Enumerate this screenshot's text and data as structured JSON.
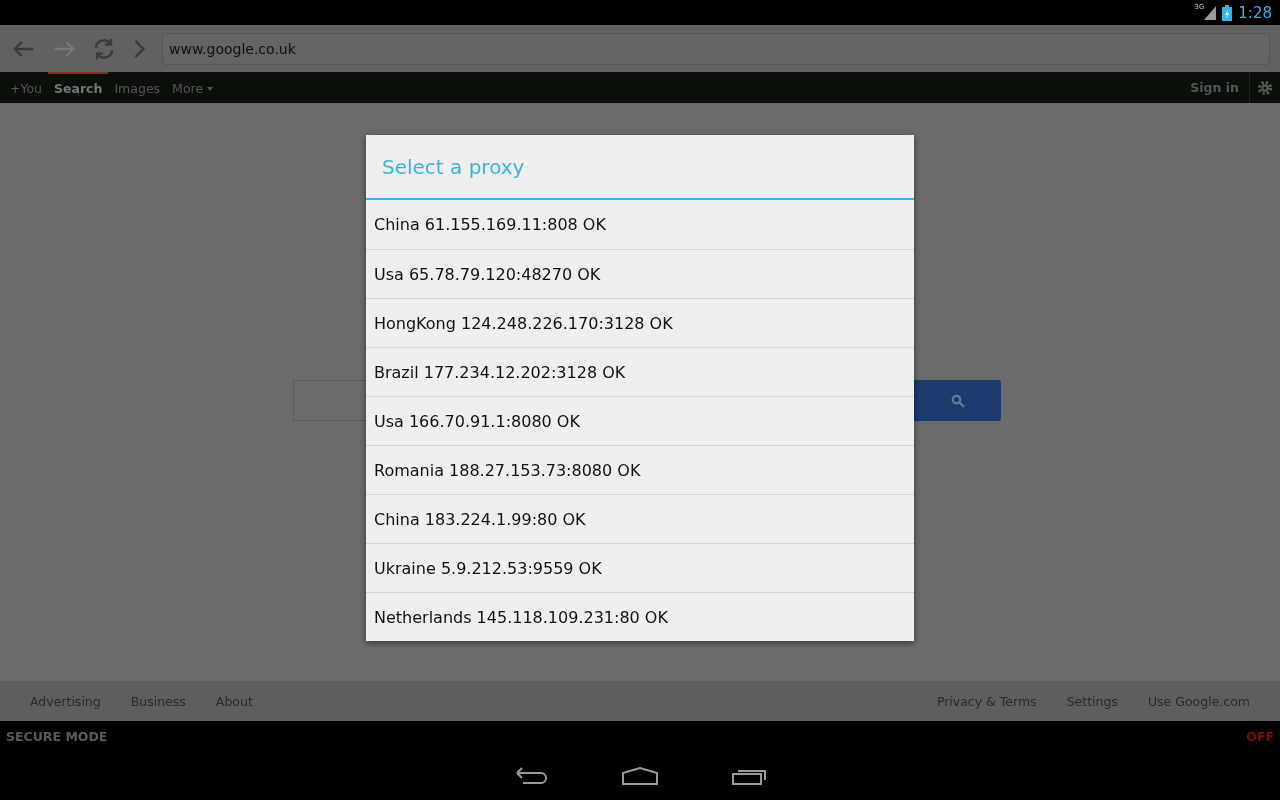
{
  "status_bar": {
    "network": "3G",
    "time": "1:28"
  },
  "browser": {
    "url": "www.google.co.uk"
  },
  "google_nav": {
    "tabs": [
      {
        "label": "+You",
        "selected": false
      },
      {
        "label": "Search",
        "selected": true
      },
      {
        "label": "Images",
        "selected": false
      },
      {
        "label": "More",
        "selected": false,
        "dropdown": true
      }
    ],
    "sign_in": "Sign in"
  },
  "dialog": {
    "title": "Select a proxy",
    "items": [
      "China 61.155.169.11:808 OK",
      "Usa 65.78.79.120:48270 OK",
      "HongKong 124.248.226.170:3128 OK",
      "Brazil 177.234.12.202:3128 OK",
      "Usa 166.70.91.1:8080 OK",
      "Romania 188.27.153.73:8080 OK",
      "China 183.224.1.99:80 OK",
      "Ukraine 5.9.212.53:9559 OK",
      "Netherlands 145.118.109.231:80 OK"
    ]
  },
  "footer": {
    "left": [
      "Advertising",
      "Business",
      "About"
    ],
    "right": [
      "Privacy & Terms",
      "Settings",
      "Use Google.com"
    ]
  },
  "secure_mode": {
    "label": "SECURE MODE",
    "value": "OFF"
  }
}
